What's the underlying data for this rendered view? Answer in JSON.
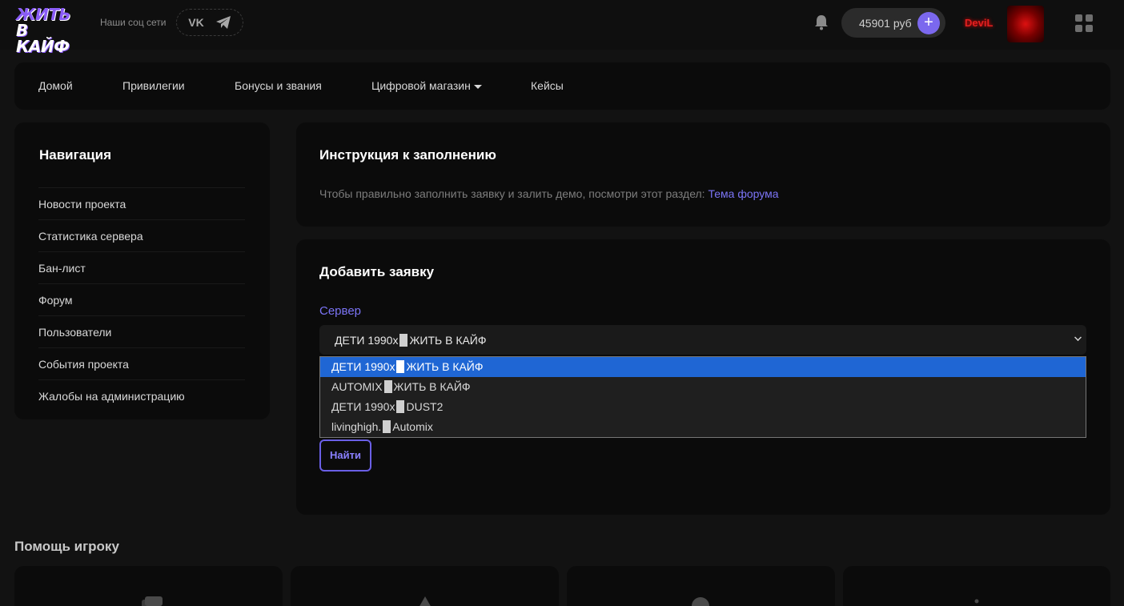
{
  "header": {
    "logo_line1": "ЖИТЬ",
    "logo_line2": "В КАЙФ",
    "social_label": "Наши соц сети",
    "social_vk": "VK",
    "balance": "45901 руб",
    "balance_add": "+",
    "username": "DeviL"
  },
  "nav": {
    "items": [
      "Домой",
      "Привилегии",
      "Бонусы и звания",
      "Цифровой магазин",
      "Кейсы"
    ]
  },
  "sidebar": {
    "title": "Навигация",
    "items": [
      "Новости проекта",
      "Статистика сервера",
      "Бан-лист",
      "Форум",
      "Пользователи",
      "События проекта",
      "Жалобы на администрацию"
    ]
  },
  "instructions": {
    "title": "Инструкция к заполнению",
    "text": "Чтобы правильно заполнить заявку и залить демо, посмотри этот раздел:",
    "link": "Тема форума"
  },
  "form": {
    "title": "Добавить заявку",
    "server_label": "Сервер",
    "selected": {
      "prefix": "ДЕТИ 1990х",
      "suffix": "ЖИТЬ В КАЙФ"
    },
    "options": [
      {
        "prefix": "ДЕТИ 1990х",
        "suffix": "ЖИТЬ В КАЙФ"
      },
      {
        "prefix": "AUTOMIX",
        "suffix": "ЖИТЬ В КАЙФ"
      },
      {
        "prefix": "ДЕТИ 1990х",
        "suffix": "DUST2"
      },
      {
        "prefix": "livinghigh.",
        "suffix": "Automix"
      }
    ],
    "find_button": "Найти"
  },
  "help": {
    "title": "Помощь игроку"
  }
}
